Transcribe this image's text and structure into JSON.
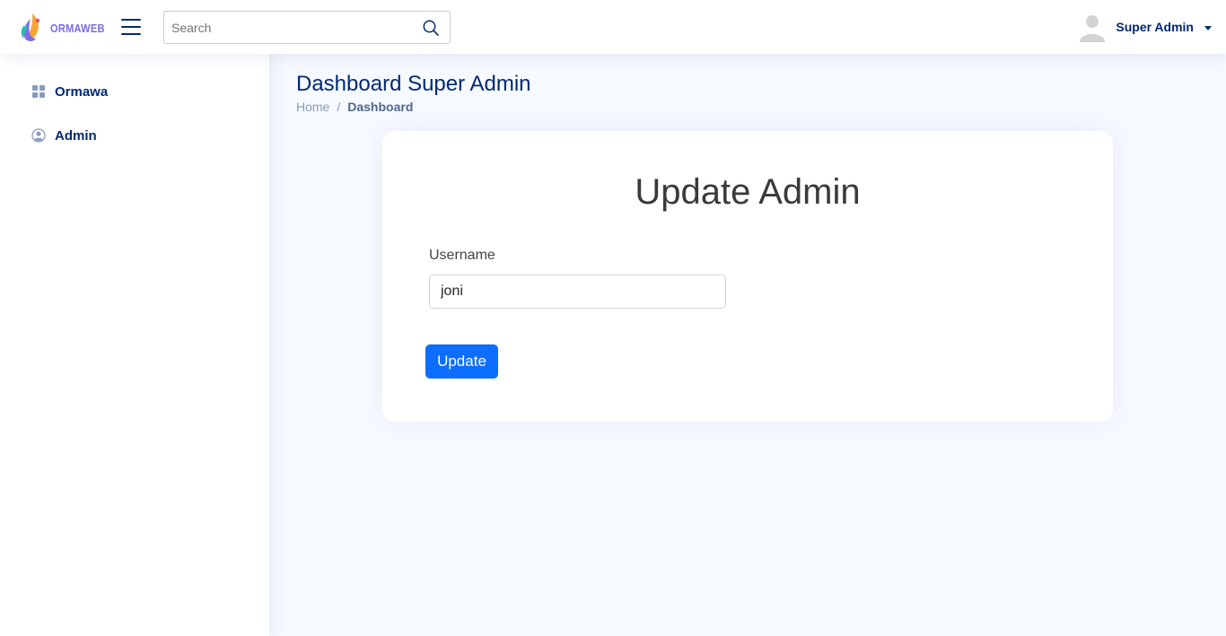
{
  "header": {
    "logo_text": "ORMAWEB",
    "search": {
      "placeholder": "Search",
      "value": ""
    },
    "profile": {
      "name": "Super Admin"
    }
  },
  "sidebar": {
    "items": [
      {
        "label": "Ormawa",
        "icon": "grid-icon"
      },
      {
        "label": "Admin",
        "icon": "person-circle-icon"
      }
    ]
  },
  "main": {
    "page_title": "Dashboard Super Admin",
    "breadcrumb": {
      "home": "Home",
      "separator": "/",
      "current": "Dashboard"
    },
    "form": {
      "title": "Update Admin",
      "username_label": "Username",
      "username_value": "joni",
      "submit_label": "Update"
    }
  },
  "colors": {
    "brand": "#012970",
    "primary_button": "#0d6efd",
    "background": "#f6f9ff",
    "logo_text": "#7b6ce8"
  }
}
